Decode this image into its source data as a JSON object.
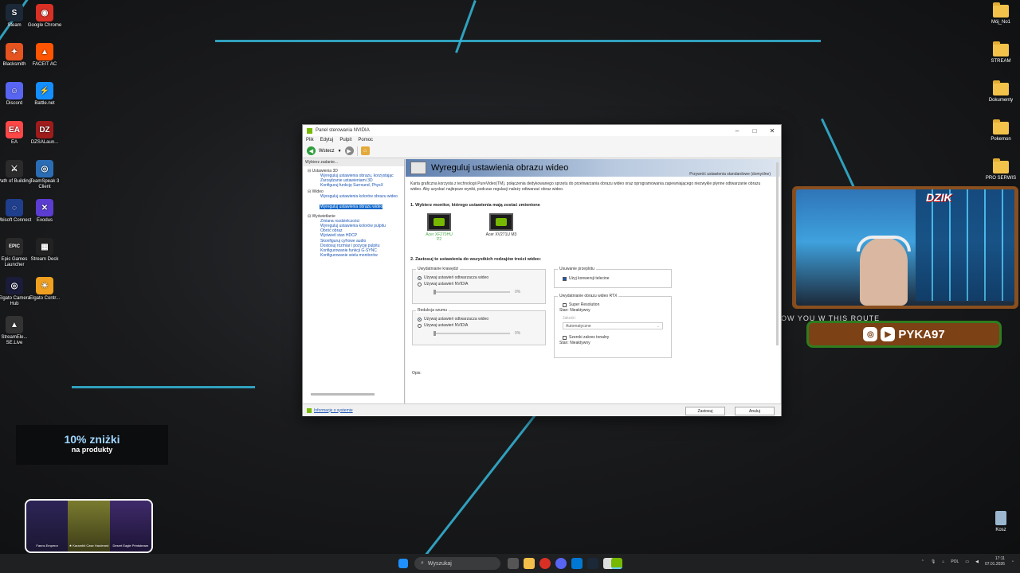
{
  "desktop": {
    "left_icons": [
      {
        "label": "Steam",
        "glyph": "S",
        "color": "#1b2838"
      },
      {
        "label": "Google Chrome",
        "glyph": "◉",
        "color": "#d93025"
      },
      {
        "label": "Blacksmith",
        "glyph": "✦",
        "color": "#e5531f"
      },
      {
        "label": "FACEIT AC",
        "glyph": "▲",
        "color": "#ff5500"
      },
      {
        "label": "Discord",
        "glyph": "☺",
        "color": "#5865f2"
      },
      {
        "label": "Battle.net",
        "glyph": "⚡",
        "color": "#148eff"
      },
      {
        "label": "EA",
        "glyph": "EA",
        "color": "#ff4747"
      },
      {
        "label": "DZSALaun...",
        "glyph": "DZ",
        "color": "#a01b1b"
      },
      {
        "label": "Path of Building",
        "glyph": "⚔",
        "color": "#2b2b2b"
      },
      {
        "label": "TeamSpeak 3 Client",
        "glyph": "◎",
        "color": "#2a6db5"
      },
      {
        "label": "Ubisoft Connect",
        "glyph": "◌",
        "color": "#1f3e8c"
      },
      {
        "label": "Exodus",
        "glyph": "✕",
        "color": "#5c3dd1"
      },
      {
        "label": "Epic Games Launcher",
        "glyph": "EPIC",
        "color": "#2a2a2a"
      },
      {
        "label": "Stream Deck",
        "glyph": "▦",
        "color": "#222"
      },
      {
        "label": "Elgato Camera Hub",
        "glyph": "◎",
        "color": "#1b1b3a"
      },
      {
        "label": "Elgato Contr...",
        "glyph": "☀",
        "color": "#f0a020"
      },
      {
        "label": "StreamEle... SE.Live",
        "glyph": "▲",
        "color": "#333"
      }
    ],
    "right_icons": [
      {
        "label": "Mój_No1"
      },
      {
        "label": "STREAM"
      },
      {
        "label": "Dokumenty"
      },
      {
        "label": "Pokemon"
      },
      {
        "label": "PRO SERWIS"
      }
    ],
    "recycle_bin": "Kosz"
  },
  "window": {
    "title": "Panel sterowania NVIDIA",
    "menu": [
      "Plik",
      "Edytuj",
      "Pulpit",
      "Pomoc"
    ],
    "toolbar": {
      "back_label": "Wstecz"
    },
    "task_header": "Wybierz zadanie...",
    "tree": [
      {
        "category": "Ustawienia 3D",
        "items": [
          "Wyreguluj ustawienia obrazu, korzystając",
          "Zarządzanie ustawieniami 3D",
          "Konfiguruj funkcję Surround, PhysX"
        ]
      },
      {
        "category": "Wideo",
        "items": [
          "Wyreguluj ustawienia kolorów obrazu wideo",
          "Wyreguluj ustawienia obrazu wideo"
        ]
      },
      {
        "category": "Wyświetlanie",
        "items": [
          "Zmiana rozdzielczości",
          "Wyreguluj ustawienia kolorów pulpitu",
          "Obróć obraz",
          "Wyświetl stan HDCP",
          "Skonfiguruj cyfrowe audio",
          "Dostosuj rozmiar i pozycję pulpitu",
          "Konfigurowanie funkcji G-SYNC",
          "Konfigurowanie wielu monitorów"
        ]
      }
    ],
    "selected_item": "Wyreguluj ustawienia obrazu wideo",
    "page_title": "Wyreguluj ustawienia obrazu wideo",
    "restore_defaults": "Przywróć ustawienia standardowe (domyślne)",
    "description": "Karta graficzna korzysta z technologii PureVideo(TM), połączenia dedykowanego sprzętu do przetwarzania obrazu wideo oraz oprogramowania zapewniającego niezwykle płynne odtwarzanie obrazu wideo. Aby uzyskać najlepsze wyniki, podczas regulacji należy odtwarzać obraz wideo.",
    "section1": "1. Wybierz monitor, którego ustawienia mają zostać zmienione",
    "monitors": [
      {
        "label": "Acer XF270HU P2",
        "selected": true
      },
      {
        "label": "Acer XV271U M3",
        "selected": false
      }
    ],
    "section2": "2. Zastosuj te ustawienia do wszystkich rodzajów treści wideo:",
    "edge": {
      "title": "Uwydatnianie krawędzi",
      "options": [
        "Używaj ustawień odtwarzacza wideo",
        "Używaj ustawień NVIDIA"
      ],
      "selected": 0,
      "slider_value": "0%"
    },
    "noise": {
      "title": "Redukcja szumu",
      "options": [
        "Używaj ustawień odtwarzacza wideo",
        "Używaj ustawień NVIDIA"
      ],
      "selected": 0,
      "slider_value": "0%"
    },
    "deinterlace": {
      "title": "Usuwanie przeplotu",
      "checkbox": "Użyj konwersji telecine",
      "checked": true
    },
    "rtx": {
      "title": "Uwydatnianie obrazu wideo RTX",
      "super_resolution": "Super Resolution",
      "status1": "Stan: Nieaktywny",
      "quality_label": "Jakość:",
      "quality_value": "Automatyczne",
      "hdr": "Szeroki zakres tonalny",
      "status2": "Stan: Nieaktywny"
    },
    "opis_label": "Opis:",
    "system_info": "Informacje o systemie",
    "apply_button": "Zastosuj",
    "cancel_button": "Anuluj"
  },
  "overlays": {
    "promo_line1": "10% zniżki",
    "promo_line2": "na produkty",
    "cards": [
      "Fanns Emperor",
      "★ Karambit Case Hardened",
      "Desert Eagle Printstream"
    ],
    "social_handle": "PYKA97",
    "cam_logo": "DZIK",
    "ticker": "OW         YOU W     THIS ROUTE"
  },
  "taskbar": {
    "search_placeholder": "Wyszukaj",
    "lang": "POL",
    "time": "17:11",
    "date": "07.01.2026"
  }
}
